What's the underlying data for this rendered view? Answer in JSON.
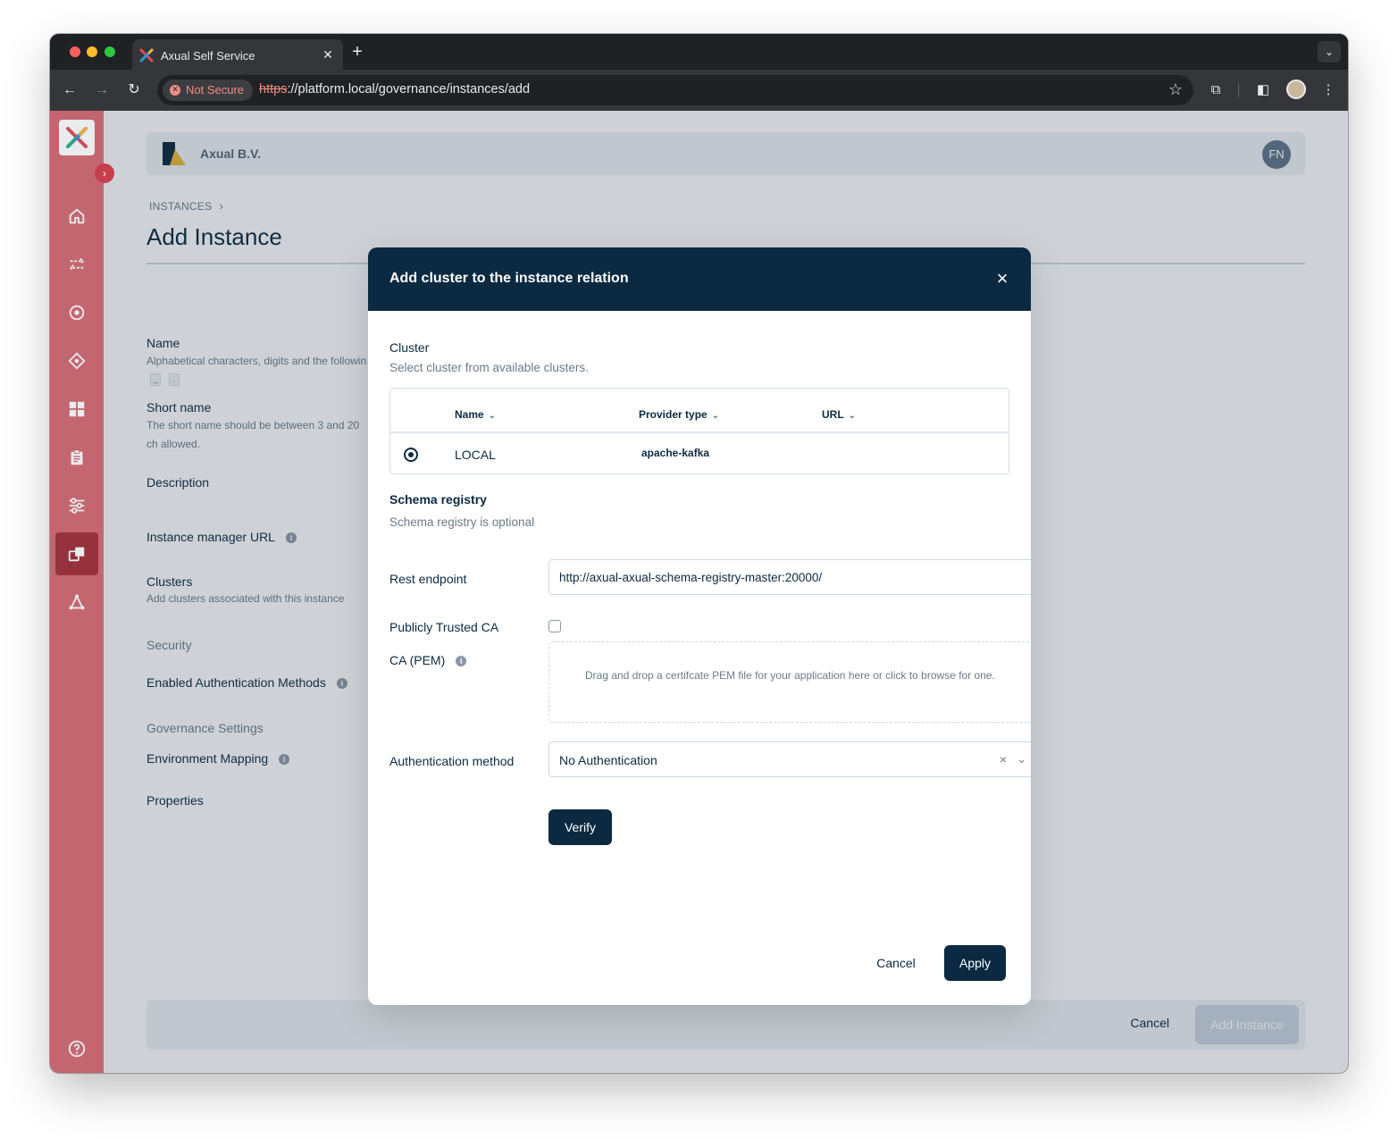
{
  "browser": {
    "tab_title": "Axual Self Service",
    "security_label": "Not Secure",
    "url_scheme": "https",
    "url_rest": "://platform.local/governance/instances/add"
  },
  "header": {
    "org_name": "Axual B.V.",
    "user_initials": "FN"
  },
  "page": {
    "breadcrumb": "INSTANCES",
    "title": "Add Instance"
  },
  "form": {
    "name_label": "Name",
    "name_hint": "Alphabetical characters, digits and the followin",
    "name_chars": [
      "_",
      "."
    ],
    "short_name_label": "Short name",
    "short_name_hint": "The short name should be between 3 and 20 ch allowed.",
    "description_label": "Description",
    "instance_manager_label": "Instance manager URL",
    "clusters_label": "Clusters",
    "clusters_hint": "Add clusters associated with this instance",
    "security_section": "Security",
    "auth_methods_label": "Enabled Authentication Methods",
    "governance_section": "Governance Settings",
    "env_mapping_label": "Environment Mapping",
    "properties_label": "Properties"
  },
  "footer": {
    "cancel_label": "Cancel",
    "add_label": "Add Instance"
  },
  "modal": {
    "title": "Add cluster to the instance relation",
    "cluster_label": "Cluster",
    "cluster_hint": "Select cluster from available clusters.",
    "table": {
      "columns": [
        "Name",
        "Provider type",
        "URL"
      ],
      "rows": [
        {
          "name": "LOCAL",
          "provider_type": "apache-kafka",
          "url": ""
        }
      ]
    },
    "schema_section": "Schema registry",
    "schema_hint": "Schema registry is optional",
    "rest_endpoint_label": "Rest endpoint",
    "rest_endpoint_value": "http://axual-axual-schema-registry-master:20000/",
    "trusted_ca_label": "Publicly Trusted CA",
    "trusted_ca_checked": false,
    "ca_pem_label": "CA (PEM)",
    "dropzone_text": "Drag and drop a certifcate PEM file for your application here or click to browse for one.",
    "auth_method_label": "Authentication method",
    "auth_method_value": "No Authentication",
    "verify_label": "Verify",
    "cancel_label": "Cancel",
    "apply_label": "Apply"
  },
  "icons": {
    "sidebar": [
      "home-icon",
      "streams-icon",
      "topics-icon",
      "schemas-icon",
      "applications-icon",
      "clipboard-icon",
      "settings-sliders-icon",
      "instances-icon",
      "network-icon",
      "help-icon"
    ]
  },
  "colors": {
    "sidebar": "#d66b75",
    "sidebar_active": "#a3313d",
    "primary": "#0b2a42"
  }
}
